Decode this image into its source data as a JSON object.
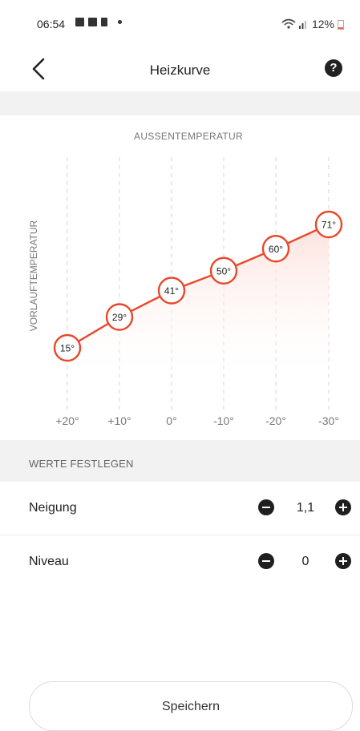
{
  "status_bar": {
    "time": "06:54",
    "battery": "12%"
  },
  "app_bar": {
    "title": "Heizkurve",
    "help_label": "?"
  },
  "chart_data": {
    "type": "line",
    "title": "AUSSENTEMPERATUR",
    "xlabel": "AUSSENTEMPERATUR",
    "ylabel": "VORLAUFTEMPERATUR",
    "categories": [
      "+20°",
      "+10°",
      "0°",
      "-10°",
      "-20°",
      "-30°"
    ],
    "values": [
      15,
      29,
      41,
      50,
      60,
      71
    ],
    "point_labels": [
      "15°",
      "29°",
      "41°",
      "50°",
      "60°",
      "71°"
    ],
    "ylim": [
      0,
      80
    ],
    "grid": "vertical-dashed",
    "line_color": "#e8482a",
    "fill_color": "#fde0dc"
  },
  "settings": {
    "section_title": "WERTE FESTLEGEN",
    "rows": [
      {
        "label": "Neigung",
        "value": "1,1"
      },
      {
        "label": "Niveau",
        "value": "0"
      }
    ]
  },
  "bottom_button": {
    "label": "Speichern"
  }
}
